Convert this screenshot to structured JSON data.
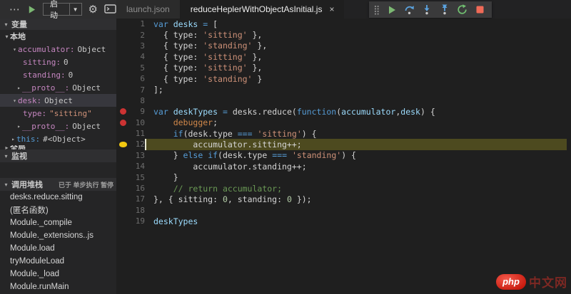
{
  "colors": {
    "bg_editor": "#1f1f1f",
    "bg_sidebar": "#252526",
    "bg_topbar": "#2e2e2f",
    "bg_tabstrip": "#222223",
    "bg_tab_active": "#1f1f1f",
    "bg_tab_inactive": "#2b2b2b",
    "bg_header": "#2f2f31",
    "bg_selrow": "#37373d",
    "bg_linehl": "#4d4a1f",
    "c_bp": "#cc3333",
    "c_ptr": "#f2c811",
    "c_kw": "#569cd6",
    "c_var": "#9cdcfe",
    "c_str": "#ce9178",
    "c_num": "#b5cea8",
    "c_com": "#6a9955",
    "c_dbg": "#d1884a",
    "c_prop": "#c586c0",
    "c_play": "#7cb873",
    "c_step": "#5ba3e0",
    "c_restart": "#71c171",
    "c_stop": "#f06a57"
  },
  "topbar": {
    "more_label": "⋯",
    "launch_label": "启动",
    "caret": "▼",
    "tabs": [
      {
        "label": "launch.json",
        "active": false
      },
      {
        "label": "reduceHeplerWithObjectAsInitial.js",
        "active": true,
        "close": "×"
      }
    ],
    "debug_toolbar": [
      "continue",
      "step-over",
      "step-into",
      "step-out",
      "restart",
      "stop"
    ]
  },
  "sidebar": {
    "variables_header": "变量",
    "watch_header": "监视",
    "callstack_header": "调用堆栈",
    "paused_text": "已于 单步执行 暂停",
    "variables": [
      {
        "pad": 5,
        "tw": "open",
        "name": "本地",
        "cls": "scope"
      },
      {
        "pad": 16,
        "tw": "open",
        "name": "accumulator",
        "value": "Object",
        "cls": "prop"
      },
      {
        "pad": 32,
        "tw": null,
        "name": "sitting",
        "value": "0",
        "cls": "prop"
      },
      {
        "pad": 32,
        "tw": null,
        "name": "standing",
        "value": "0",
        "cls": "prop"
      },
      {
        "pad": 22,
        "tw": "closed",
        "name": "__proto__",
        "value": "Object",
        "cls": "prop"
      },
      {
        "pad": 16,
        "tw": "open",
        "name": "desk",
        "value": "Object",
        "cls": "prop",
        "selected": true
      },
      {
        "pad": 32,
        "tw": null,
        "name": "type",
        "value": "\"sitting\"",
        "cls": "prop",
        "vcls": "str"
      },
      {
        "pad": 22,
        "tw": "closed",
        "name": "__proto__",
        "value": "Object",
        "cls": "prop"
      },
      {
        "pad": 14,
        "tw": "closed",
        "name": "this",
        "value": "#<Object>",
        "cls": "kw"
      },
      {
        "pad": 5,
        "tw": "closed",
        "name": "全局",
        "cls": "scope",
        "clipped": true
      }
    ],
    "callstack": [
      "desks.reduce.sitting",
      "(匿名函数)",
      "Module._compile",
      "Module._extensions..js",
      "Module.load",
      "tryModuleLoad",
      "Module._load",
      "Module.runMain"
    ]
  },
  "editor": {
    "lines": [
      {
        "n": 1,
        "t": [
          [
            "k",
            "var"
          ],
          [
            "p",
            " "
          ],
          [
            "v",
            "desks"
          ],
          [
            "k",
            " ="
          ],
          [
            "p",
            " ["
          ]
        ]
      },
      {
        "n": 2,
        "t": [
          [
            "p",
            "  { type: "
          ],
          [
            "s",
            "'sitting'"
          ],
          [
            "p",
            " },"
          ]
        ]
      },
      {
        "n": 3,
        "t": [
          [
            "p",
            "  { type: "
          ],
          [
            "s",
            "'standing'"
          ],
          [
            "p",
            " },"
          ]
        ]
      },
      {
        "n": 4,
        "t": [
          [
            "p",
            "  { type: "
          ],
          [
            "s",
            "'sitting'"
          ],
          [
            "p",
            " },"
          ]
        ]
      },
      {
        "n": 5,
        "t": [
          [
            "p",
            "  { type: "
          ],
          [
            "s",
            "'sitting'"
          ],
          [
            "p",
            " },"
          ]
        ]
      },
      {
        "n": 6,
        "t": [
          [
            "p",
            "  { type: "
          ],
          [
            "s",
            "'standing'"
          ],
          [
            "p",
            " }"
          ]
        ]
      },
      {
        "n": 7,
        "t": [
          [
            "p",
            "];"
          ]
        ]
      },
      {
        "n": 8,
        "t": []
      },
      {
        "n": 9,
        "t": [
          [
            "k",
            "var"
          ],
          [
            "p",
            " "
          ],
          [
            "v",
            "deskTypes"
          ],
          [
            "k",
            " ="
          ],
          [
            "p",
            " desks.reduce("
          ],
          [
            "k",
            "function"
          ],
          [
            "p",
            "("
          ],
          [
            "v",
            "accumulator"
          ],
          [
            "p",
            ","
          ],
          [
            "v",
            "desk"
          ],
          [
            "p",
            ") {"
          ]
        ],
        "bp": true
      },
      {
        "n": 10,
        "t": [
          [
            "p",
            "    "
          ],
          [
            "d",
            "debugger"
          ],
          [
            "p",
            ";"
          ]
        ],
        "bp": true
      },
      {
        "n": 11,
        "t": [
          [
            "p",
            "    "
          ],
          [
            "k",
            "if"
          ],
          [
            "p",
            "(desk.type "
          ],
          [
            "k",
            "==="
          ],
          [
            "p",
            " "
          ],
          [
            "s",
            "'sitting'"
          ],
          [
            "p",
            ") {"
          ]
        ]
      },
      {
        "n": 12,
        "t": [
          [
            "p",
            "        accumulator.sitting++;"
          ]
        ],
        "current": true
      },
      {
        "n": 13,
        "t": [
          [
            "p",
            "    } "
          ],
          [
            "k",
            "else"
          ],
          [
            "p",
            " "
          ],
          [
            "k",
            "if"
          ],
          [
            "p",
            "(desk.type "
          ],
          [
            "k",
            "==="
          ],
          [
            "p",
            " "
          ],
          [
            "s",
            "'standing'"
          ],
          [
            "p",
            ") {"
          ]
        ]
      },
      {
        "n": 14,
        "t": [
          [
            "p",
            "        accumulator.standing++;"
          ]
        ]
      },
      {
        "n": 15,
        "t": [
          [
            "p",
            "    }"
          ]
        ]
      },
      {
        "n": 16,
        "t": [
          [
            "p",
            "    "
          ],
          [
            "c",
            "// return accumulator;"
          ]
        ]
      },
      {
        "n": 17,
        "t": [
          [
            "p",
            "}, { sitting: "
          ],
          [
            "n2",
            "0"
          ],
          [
            "p",
            ", standing: "
          ],
          [
            "n2",
            "0"
          ],
          [
            "p",
            " });"
          ]
        ]
      },
      {
        "n": 18,
        "t": []
      },
      {
        "n": 19,
        "t": [
          [
            "v",
            "deskTypes"
          ]
        ]
      }
    ]
  },
  "watermark": {
    "badge": "php",
    "text": "中文网"
  }
}
